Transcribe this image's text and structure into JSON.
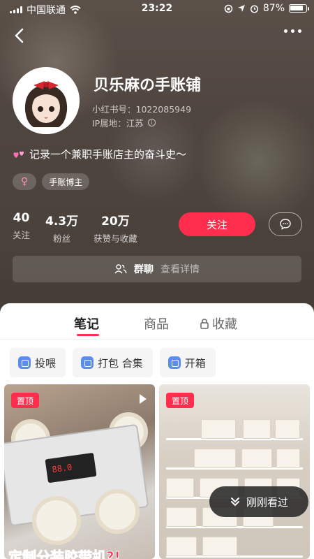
{
  "status_bar": {
    "carrier": "中国联通",
    "time": "23:22",
    "battery": "87%",
    "battery_level": 0.87
  },
  "profile": {
    "name": "贝乐麻の手账铺",
    "id_label": "小红书号：1022085949",
    "ip_label": "IP属地：江苏",
    "bio": "记录一个兼职手账店主的奋斗史～",
    "tags": {
      "gender": "♀",
      "role": "手账博主"
    },
    "stats": [
      {
        "num": "40",
        "label": "关注"
      },
      {
        "num": "4.3万",
        "label": "粉丝"
      },
      {
        "num": "20万",
        "label": "获赞与收藏"
      }
    ],
    "follow_label": "关注",
    "group_chat": {
      "label": "群聊",
      "detail": "查看详情"
    }
  },
  "tabs": {
    "notes": "笔记",
    "products": "商品",
    "favorites": "收藏"
  },
  "chips": [
    "投喂",
    "打包 合集",
    "开箱"
  ],
  "cards": [
    {
      "pin": "置顶",
      "title_partial": "定制分装胶带机?!"
    },
    {
      "pin": "置顶"
    }
  ],
  "machine_digits": "88.0",
  "recent_label": "刚刚看过",
  "colors": {
    "accent": "#ff2e4d",
    "chip_icon": "#5b8def"
  }
}
